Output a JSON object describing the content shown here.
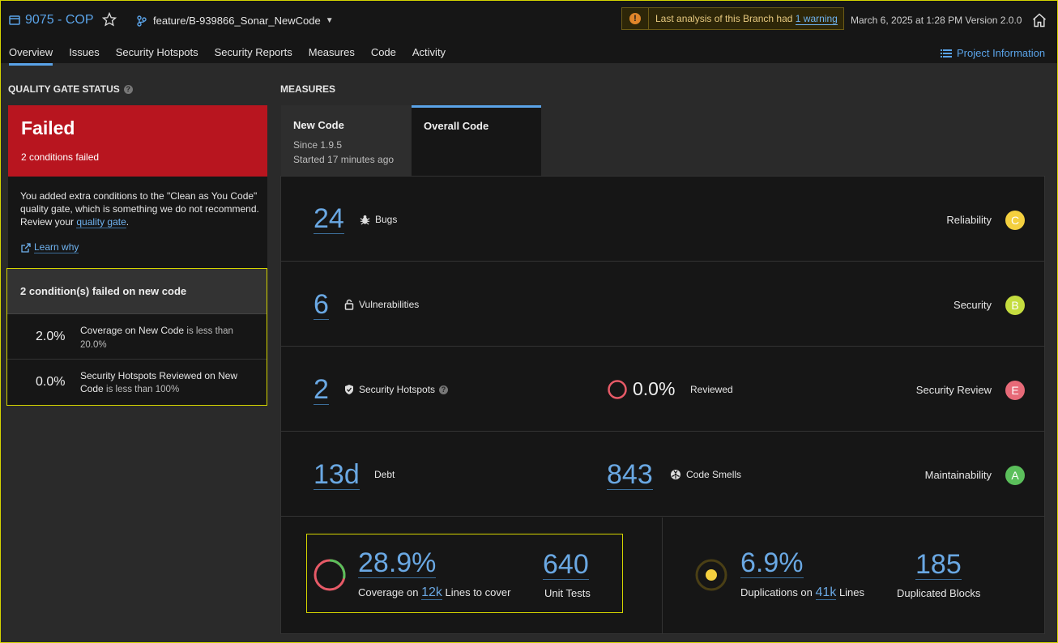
{
  "header": {
    "project_name": "9075 - COP",
    "branch_name": "feature/B-939866_Sonar_NewCode",
    "warning_text": "Last analysis of this Branch had",
    "warning_link": "1 warning",
    "date_version": "March 6, 2025 at 1:28 PM  Version 2.0.0"
  },
  "nav": {
    "tabs": [
      "Overview",
      "Issues",
      "Security Hotspots",
      "Security Reports",
      "Measures",
      "Code",
      "Activity"
    ],
    "project_info": "Project Information"
  },
  "quality_gate": {
    "title": "QUALITY GATE STATUS",
    "status": "Failed",
    "summary": "2 conditions failed",
    "message": "You added extra conditions to the \"Clean as You Code\" quality gate, which is something we do not recommend. Review your",
    "message_link": "quality gate",
    "message_end": ".",
    "learn_why": "Learn why",
    "failed_header": "2 condition(s) failed on new code",
    "conditions": [
      {
        "value": "2.0%",
        "metric": "Coverage on New Code",
        "rule": "is less than 20.0%"
      },
      {
        "value": "0.0%",
        "metric": "Security Hotspots Reviewed on New Code",
        "rule": "is less than 100%"
      }
    ]
  },
  "measures": {
    "title": "MEASURES",
    "tab_new": {
      "label": "New Code",
      "since": "Since 1.9.5",
      "started": "Started 17 minutes ago"
    },
    "tab_overall": {
      "label": "Overall Code"
    },
    "bugs": {
      "value": "24",
      "label": "Bugs",
      "category": "Reliability",
      "rating": "C",
      "rating_color": "#f4d03f"
    },
    "vulnerabilities": {
      "value": "6",
      "label": "Vulnerabilities",
      "category": "Security",
      "rating": "B",
      "rating_color": "#c5dd3f"
    },
    "hotspots": {
      "value": "2",
      "label": "Security Hotspots",
      "reviewed_value": "0.0%",
      "reviewed_label": "Reviewed",
      "category": "Security Review",
      "rating": "E",
      "rating_color": "#e76a78"
    },
    "maintainability": {
      "debt_value": "13d",
      "debt_label": "Debt",
      "smells_value": "843",
      "smells_label": "Code Smells",
      "category": "Maintainability",
      "rating": "A",
      "rating_color": "#5bbf5b"
    },
    "coverage": {
      "value": "28.9%",
      "label_prefix": "Coverage on",
      "lines_value": "12k",
      "label_suffix": "Lines to cover",
      "tests_value": "640",
      "tests_label": "Unit Tests",
      "fraction": 0.289
    },
    "duplications": {
      "value": "6.9%",
      "label_prefix": "Duplications on",
      "lines_value": "41k",
      "label_suffix": "Lines",
      "blocks_value": "185",
      "blocks_label": "Duplicated Blocks"
    }
  },
  "colors": {
    "accent": "#5aa3e8",
    "failed": "#b8151f",
    "highlight": "#d4d400"
  }
}
